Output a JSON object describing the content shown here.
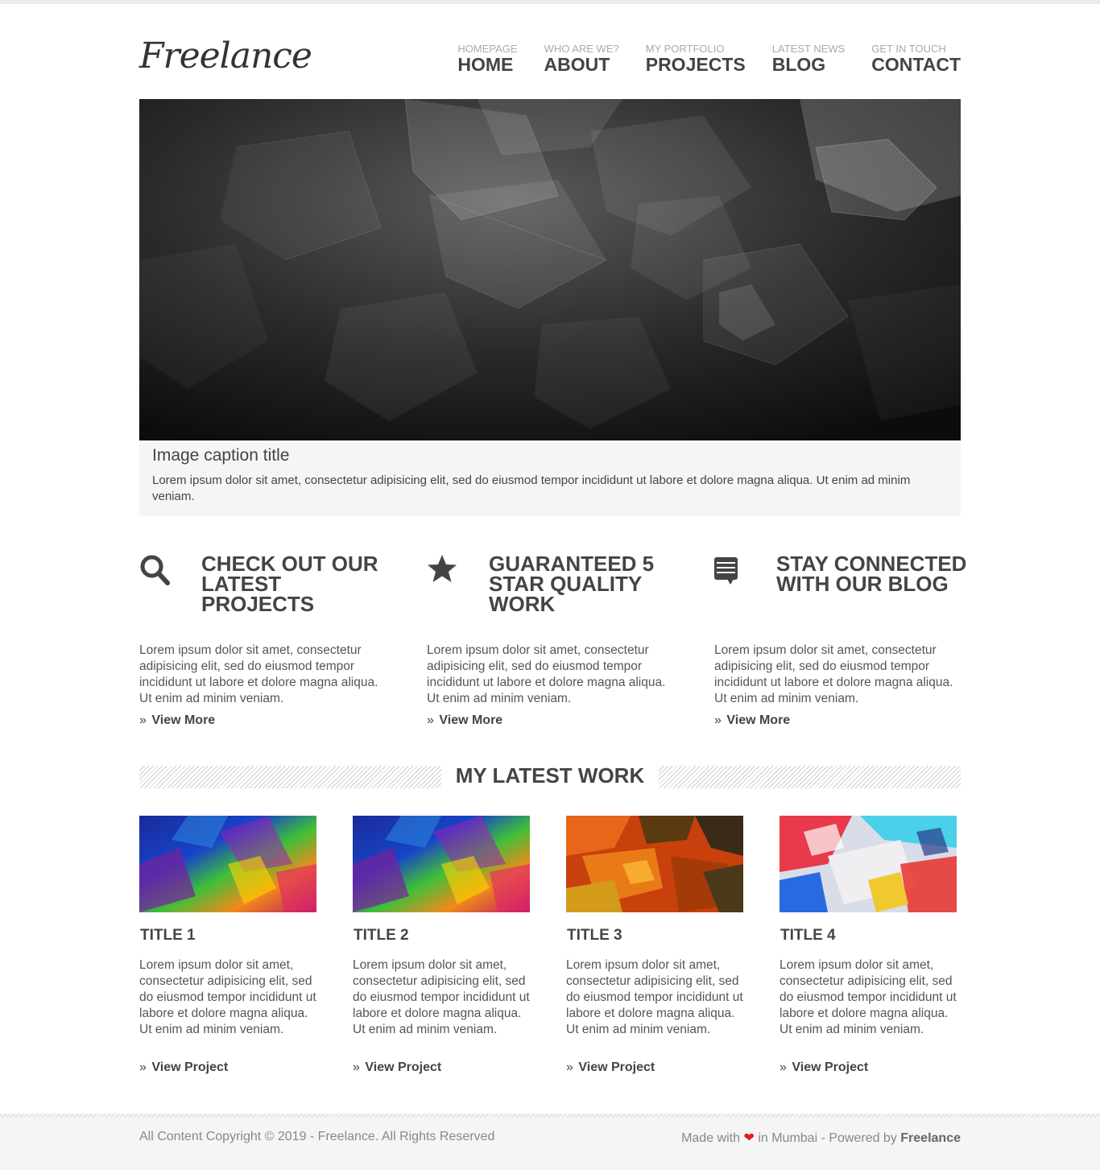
{
  "header": {
    "logo": "Freelance",
    "nav": [
      {
        "sub": "HOMEPAGE",
        "label": "HOME"
      },
      {
        "sub": "WHO ARE WE?",
        "label": "ABOUT"
      },
      {
        "sub": "MY PORTFOLIO",
        "label": "PROJECTS"
      },
      {
        "sub": "LATEST NEWS",
        "label": "BLOG"
      },
      {
        "sub": "GET IN TOUCH",
        "label": "CONTACT"
      }
    ]
  },
  "hero": {
    "caption_title": "Image caption title",
    "caption_text": "Lorem ipsum dolor sit amet, consectetur adipisicing elit, sed do eiusmod tempor incididunt ut labore et dolore magna aliqua. Ut enim ad minim veniam."
  },
  "features": [
    {
      "icon": "search-icon",
      "title": "CHECK OUT OUR LATEST PROJECTS",
      "text": "Lorem ipsum dolor sit amet, consectetur adipisicing elit, sed do eiusmod tempor incididunt ut labore et dolore magna aliqua. Ut enim ad minim veniam.",
      "link": "View More"
    },
    {
      "icon": "star-icon",
      "title": "GUARANTEED 5 STAR QUALITY WORK",
      "text": "Lorem ipsum dolor sit amet, consectetur adipisicing elit, sed do eiusmod tempor incididunt ut labore et dolore magna aliqua. Ut enim ad minim veniam.",
      "link": "View More"
    },
    {
      "icon": "comment-icon",
      "title": "STAY CONNECTED WITH OUR BLOG",
      "text": "Lorem ipsum dolor sit amet, consectetur adipisicing elit, sed do eiusmod tempor incididunt ut labore et dolore magna aliqua. Ut enim ad minim veniam.",
      "link": "View More"
    }
  ],
  "latest_work": {
    "heading": "MY LATEST WORK",
    "items": [
      {
        "title": "TITLE 1",
        "text": "Lorem ipsum dolor sit amet, consectetur adipisicing elit, sed do eiusmod tempor incididunt ut labore et dolore magna aliqua. Ut enim ad minim veniam.",
        "link": "View Project"
      },
      {
        "title": "TITLE 2",
        "text": "Lorem ipsum dolor sit amet, consectetur adipisicing elit, sed do eiusmod tempor incididunt ut labore et dolore magna aliqua. Ut enim ad minim veniam.",
        "link": "View Project"
      },
      {
        "title": "TITLE 3",
        "text": "Lorem ipsum dolor sit amet, consectetur adipisicing elit, sed do eiusmod tempor incididunt ut labore et dolore magna aliqua. Ut enim ad minim veniam.",
        "link": "View Project"
      },
      {
        "title": "TITLE 4",
        "text": "Lorem ipsum dolor sit amet, consectetur adipisicing elit, sed do eiusmod tempor incididunt ut labore et dolore magna aliqua. Ut enim ad minim veniam.",
        "link": "View Project"
      }
    ]
  },
  "footer": {
    "copyright": "All Content Copyright © 2019 - Freelance. All Rights Reserved",
    "made_with": "Made with",
    "in_city": "in Mumbai - Powered by",
    "brand": "Freelance"
  },
  "colors": {
    "heart": "#e31b23",
    "text_dark": "#444444",
    "text_muted": "#888888",
    "panel": "#f5f5f5"
  }
}
